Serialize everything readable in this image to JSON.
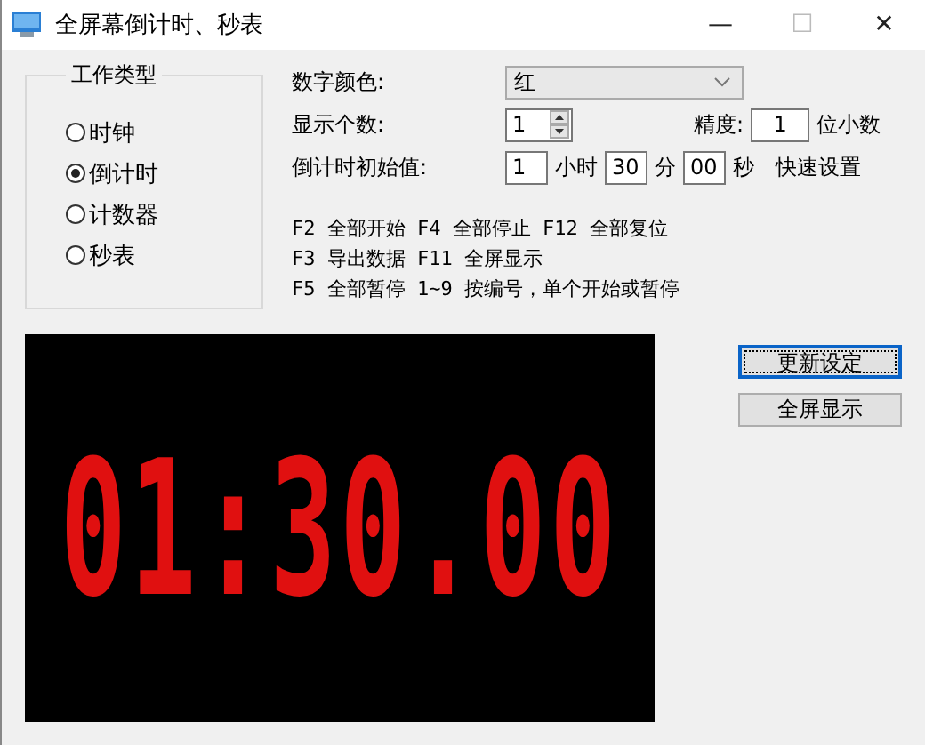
{
  "window": {
    "title": "全屏幕倒计时、秒表",
    "controls": [
      "—",
      "☐",
      "✕"
    ]
  },
  "work_type": {
    "legend": "工作类型",
    "options": [
      {
        "label": "时钟",
        "selected": false
      },
      {
        "label": "倒计时",
        "selected": true
      },
      {
        "label": "计数器",
        "selected": false
      },
      {
        "label": "秒表",
        "selected": false
      }
    ]
  },
  "digit_color": {
    "label": "数字颜色:",
    "value": "红"
  },
  "display_count": {
    "label": "显示个数:",
    "value": "1"
  },
  "precision": {
    "label": "精度:",
    "value": "1",
    "unit": "位小数"
  },
  "countdown_initial": {
    "label": "倒计时初始值:",
    "hours": "1",
    "hours_unit": "小时",
    "minutes": "30",
    "minutes_unit": "分",
    "seconds": "00",
    "seconds_unit": "秒",
    "quick_settings": "快速设置"
  },
  "hotkeys": [
    "F2 全部开始 F4 全部停止 F12 全部复位",
    "F3 导出数据 F11 全屏显示",
    "F5 全部暂停 1~9 按编号，单个开始或暂停"
  ],
  "display": {
    "time": "01:30.00"
  },
  "buttons": [
    {
      "label": "更新设定",
      "focused": true
    },
    {
      "label": "全屏显示",
      "focused": false
    }
  ]
}
